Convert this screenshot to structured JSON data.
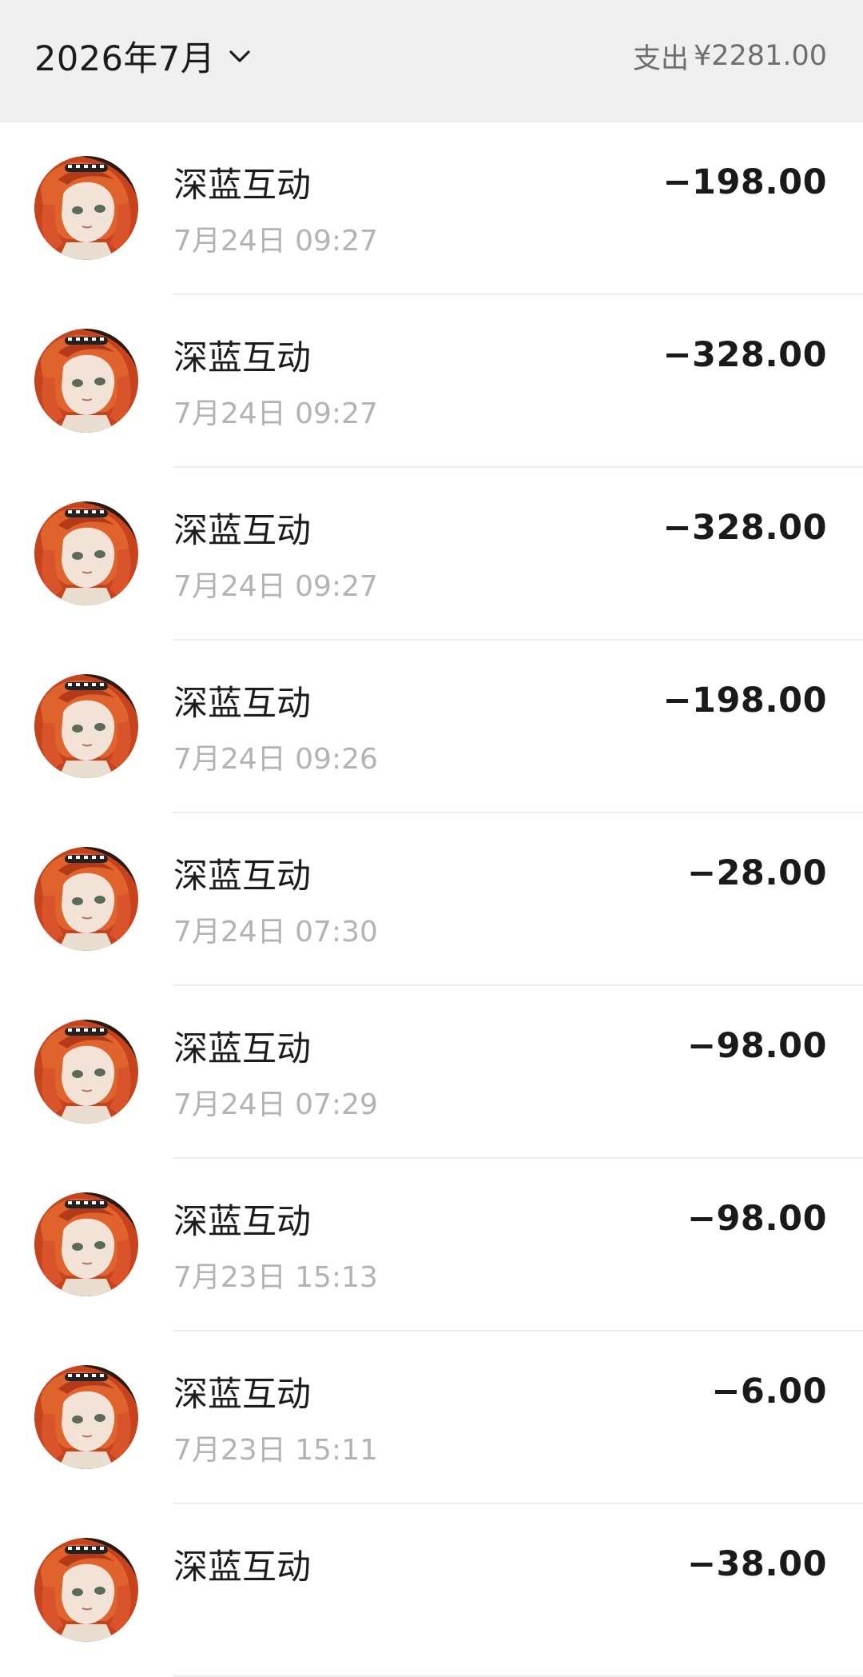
{
  "header": {
    "month_label": "2026年7月",
    "summary_label": "支出",
    "summary_amount": "¥2281.00"
  },
  "transactions": [
    {
      "merchant": "深蓝互动",
      "time": "7月24日 09:27",
      "amount": "−198.00"
    },
    {
      "merchant": "深蓝互动",
      "time": "7月24日 09:27",
      "amount": "−328.00"
    },
    {
      "merchant": "深蓝互动",
      "time": "7月24日 09:27",
      "amount": "−328.00"
    },
    {
      "merchant": "深蓝互动",
      "time": "7月24日 09:26",
      "amount": "−198.00"
    },
    {
      "merchant": "深蓝互动",
      "time": "7月24日 07:30",
      "amount": "−28.00"
    },
    {
      "merchant": "深蓝互动",
      "time": "7月24日 07:29",
      "amount": "−98.00"
    },
    {
      "merchant": "深蓝互动",
      "time": "7月23日 15:13",
      "amount": "−98.00"
    },
    {
      "merchant": "深蓝互动",
      "time": "7月23日 15:11",
      "amount": "−6.00"
    },
    {
      "merchant": "深蓝互动",
      "time": "",
      "amount": "−38.00"
    }
  ],
  "colors": {
    "header_bg": "#efefef",
    "text_primary": "#1a1a1a",
    "text_secondary": "#b3b3b3",
    "avatar_hair": "#d9542a"
  }
}
